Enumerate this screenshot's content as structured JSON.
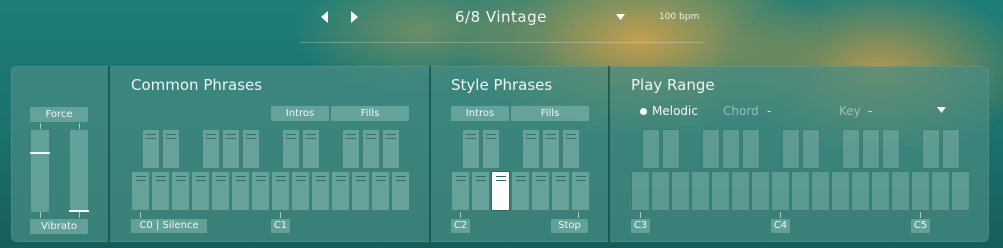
{
  "header": {
    "preset": "6/8 Vintage",
    "tempo": "100 bpm"
  },
  "controls": {
    "force_label": "Force",
    "force_level": 0.72,
    "vibrato_label": "Vibrato",
    "vibrato_level": 0.0
  },
  "common_phrases": {
    "title": "Common Phrases",
    "intros_label": "Intros",
    "fills_label": "Fills",
    "start_label": "C0 | Silence",
    "c1_label": "C1"
  },
  "style_phrases": {
    "title": "Style Phrases",
    "intros_label": "Intros",
    "fills_label": "Fills",
    "c2_label": "C2",
    "stop_label": "Stop"
  },
  "play_range": {
    "title": "Play Range",
    "mode_label": "Melodic",
    "chord_label": "Chord",
    "chord_value": "-",
    "key_label": "Key",
    "key_value": "-",
    "c3_label": "C3",
    "c4_label": "C4",
    "c5_label": "C5"
  },
  "colors": {
    "accent": "#ffffff",
    "panel": "#468c82"
  },
  "icons": {
    "prev": "triangle-left-icon",
    "next": "triangle-right-icon",
    "dropdown": "caret-down-icon"
  }
}
